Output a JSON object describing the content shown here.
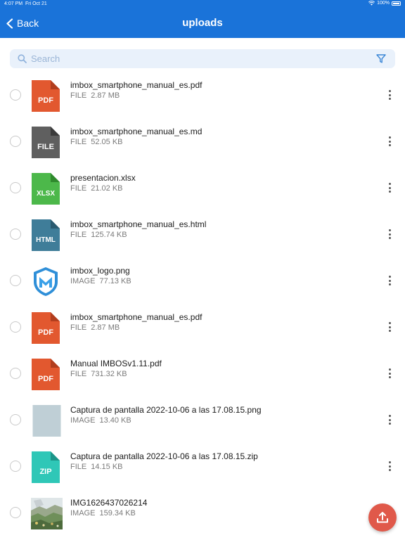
{
  "status_bar": {
    "time": "4:07 PM",
    "date": "Fri Oct 21",
    "battery": "100%"
  },
  "navbar": {
    "back_label": "Back",
    "title": "uploads"
  },
  "search": {
    "placeholder": "Search"
  },
  "files": [
    {
      "name": "imbox_smartphone_manual_es.pdf",
      "kind": "FILE",
      "size": "2.87 MB",
      "icon": "pdf-icon",
      "label": "PDF",
      "color": "#e2582f"
    },
    {
      "name": "imbox_smartphone_manual_es.md",
      "kind": "FILE",
      "size": "52.05 KB",
      "icon": "generic-file-icon",
      "label": "FILE",
      "color": "#5f5f5f"
    },
    {
      "name": "presentacion.xlsx",
      "kind": "FILE",
      "size": "21.02 KB",
      "icon": "xlsx-icon",
      "label": "XLSX",
      "color": "#4cb84a"
    },
    {
      "name": "imbox_smartphone_manual_es.html",
      "kind": "FILE",
      "size": "125.74 KB",
      "icon": "html-icon",
      "label": "HTML",
      "color": "#3f7d99"
    },
    {
      "name": "imbox_logo.png",
      "kind": "IMAGE",
      "size": "77.13 KB",
      "icon": "imbox-logo-thumbnail",
      "color": "#2f8fd8"
    },
    {
      "name": "imbox_smartphone_manual_es.pdf",
      "kind": "FILE",
      "size": "2.87 MB",
      "icon": "pdf-icon",
      "label": "PDF",
      "color": "#e2582f"
    },
    {
      "name": "Manual IMBOSv1.11.pdf",
      "kind": "FILE",
      "size": "731.32 KB",
      "icon": "pdf-icon",
      "label": "PDF",
      "color": "#e2582f"
    },
    {
      "name": "Captura de pantalla 2022-10-06 a las 17.08.15.png",
      "kind": "IMAGE",
      "size": "13.40 KB",
      "icon": "screenshot-thumbnail",
      "color": "#bfcfd6"
    },
    {
      "name": "Captura de pantalla 2022-10-06 a las 17.08.15.zip",
      "kind": "FILE",
      "size": "14.15 KB",
      "icon": "zip-icon",
      "label": "ZIP",
      "color": "#2fc7b7"
    },
    {
      "name": "IMG1626437026214",
      "kind": "IMAGE",
      "size": "159.34 KB",
      "icon": "photo-thumbnail",
      "color": "#6f8f5a"
    }
  ],
  "colors": {
    "accent": "#1a73d9",
    "fab": "#e0594a"
  },
  "fab_icon": "upload-icon"
}
